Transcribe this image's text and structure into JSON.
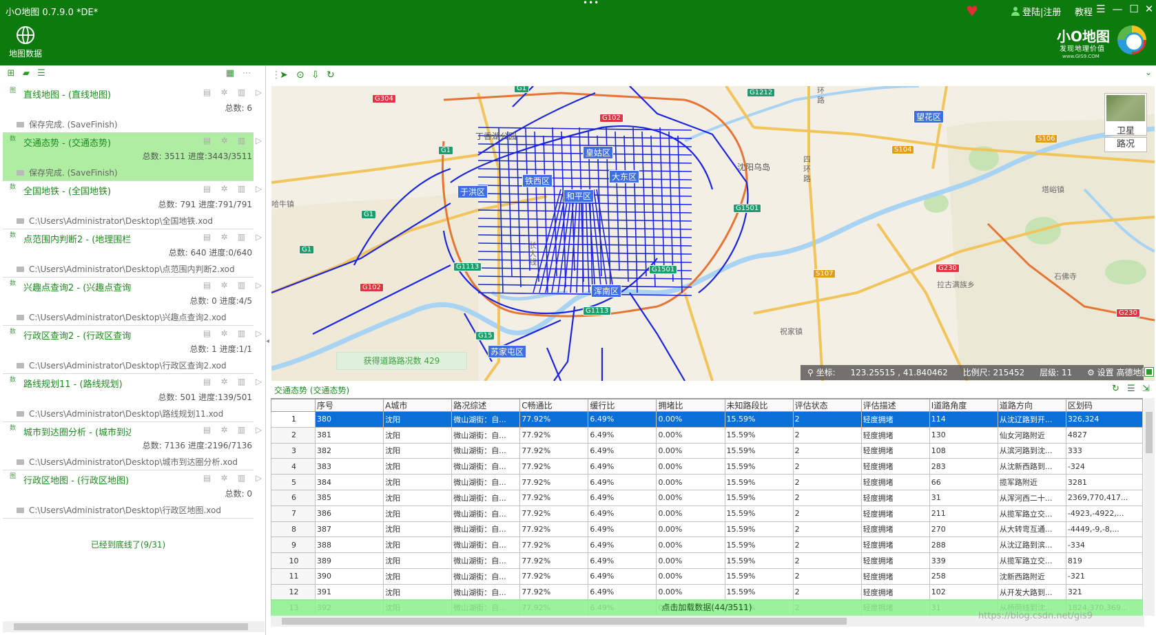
{
  "app": {
    "title": "小O地图 0.7.9.0 *DE*",
    "drag_handle": "•••"
  },
  "header": {
    "login_label": "登陆|注册",
    "tutorial_label": "教程",
    "menu_glyph": "☰",
    "minimize_glyph": "—",
    "maximize_glyph": "☐",
    "close_glyph": "✕",
    "ribbon_map_data_label": "地图数据",
    "brand_name": "小O地图",
    "brand_slogan": "发现地理价值",
    "brand_url": "www.GIS9.COM",
    "colors": {
      "titlebar": "#0d7a0d",
      "heart": "#e52d38"
    }
  },
  "left_panel": {
    "tasks": [
      {
        "kind": "图",
        "name": "直线地图 - (直线地图)",
        "stats": "总数: 6",
        "path": "保存完成. (SaveFinish)",
        "selected": false
      },
      {
        "kind": "数",
        "name": "交通态势 - (交通态势)",
        "stats": "总数: 3511 进度:3443/3511",
        "path": "保存完成. (SaveFinish)",
        "selected": true
      },
      {
        "kind": "数",
        "name": "全国地铁 - (全国地铁)",
        "stats": "总数: 791 进度:791/791",
        "path": "C:\\Users\\Administrator\\Desktop\\全国地铁.xod",
        "selected": false
      },
      {
        "kind": "数",
        "name": "点范围内判断2 - (地理围栏)",
        "stats": "总数: 640 进度:0/640",
        "path": "C:\\Users\\Administrator\\Desktop\\点范围内判断2.xod",
        "selected": false
      },
      {
        "kind": "数",
        "name": "兴趣点查询2 - (兴趣点查询)",
        "stats": "总数: 0 进度:4/5",
        "path": "C:\\Users\\Administrator\\Desktop\\兴趣点查询2.xod",
        "selected": false
      },
      {
        "kind": "数",
        "name": "行政区查询2 - (行政区查询)",
        "stats": "总数: 1 进度:1/1",
        "path": "C:\\Users\\Administrator\\Desktop\\行政区查询2.xod",
        "selected": false
      },
      {
        "kind": "数",
        "name": "路线规划11 - (路线规划)",
        "stats": "总数: 501 进度:139/501",
        "path": "C:\\Users\\Administrator\\Desktop\\路线规划11.xod",
        "selected": false
      },
      {
        "kind": "数",
        "name": "城市到达圈分析 - (城市到达圈",
        "stats": "总数: 7136 进度:2196/7136",
        "path": "C:\\Users\\Administrator\\Desktop\\城市到达圈分析.xod",
        "selected": false
      },
      {
        "kind": "图",
        "name": "行政区地图 - (行政区地图)",
        "stats": "总数: 0",
        "path": "C:\\Users\\Administrator\\Desktop\\行政区地图.xod",
        "selected": false
      }
    ],
    "bottom_message": "已经到底线了(9/31)"
  },
  "map": {
    "districts": [
      "皇姑区",
      "铁西区",
      "于洪区",
      "大东区",
      "和平区",
      "浑南区",
      "苏家屯区"
    ],
    "shields": [
      "G1",
      "G304",
      "G102",
      "G1",
      "G1",
      "G1",
      "G1212",
      "G1501",
      "G1501",
      "G1113",
      "G1113",
      "G102",
      "G15",
      "G230",
      "G230",
      "S104",
      "S106",
      "S107"
    ],
    "place_labels": [
      "丁香湖公园",
      "沈阳乌岛",
      "望花区",
      "哈牛镇",
      "塔峪镇",
      "拉古满族乡",
      "石佛寺",
      "祝家镇",
      "长大线",
      "四环路",
      "环路"
    ],
    "satellite_label": "卫星",
    "traffic_label": "路况",
    "toast": "获得道路路况数 429",
    "status": {
      "coord_label": "坐标:",
      "coord_value": "123.25515 , 41.840462",
      "scale_label": "比例尺:",
      "scale_value": "215452",
      "level_label": "层级:",
      "level_value": "11",
      "settings_label": "设置 高德地图"
    },
    "colors": {
      "roads": "#1a24e0",
      "district_label": "#3d6fe3",
      "shield_national": "#1c9d6c",
      "shield_provincial": "#e29c18"
    }
  },
  "grid": {
    "title": "交通态势 (交通态势)",
    "columns": [
      "序号",
      "A城市",
      "路况综述",
      "C畅通比",
      "缓行比",
      "拥堵比",
      "未知路段比",
      "评估状态",
      "评估描述",
      "I道路角度",
      "道路方向",
      "区划码"
    ],
    "rows": [
      {
        "n": "1",
        "c": [
          "380",
          "沈阳",
          "微山湖街：自...",
          "77.92%",
          "6.49%",
          "0.00%",
          "15.59%",
          "2",
          "轻度拥堵",
          "114",
          "从沈辽路到开...",
          "326,324"
        ]
      },
      {
        "n": "2",
        "c": [
          "381",
          "沈阳",
          "微山湖街：自...",
          "77.92%",
          "6.49%",
          "0.00%",
          "15.59%",
          "2",
          "轻度拥堵",
          "130",
          "仙女河路附近",
          "4827"
        ]
      },
      {
        "n": "3",
        "c": [
          "382",
          "沈阳",
          "微山湖街：自...",
          "77.92%",
          "6.49%",
          "0.00%",
          "15.59%",
          "2",
          "轻度拥堵",
          "108",
          "从滨河路到沈...",
          "333"
        ]
      },
      {
        "n": "4",
        "c": [
          "383",
          "沈阳",
          "微山湖街：自...",
          "77.92%",
          "6.49%",
          "0.00%",
          "15.59%",
          "2",
          "轻度拥堵",
          "283",
          "从沈新西路到...",
          "-324"
        ]
      },
      {
        "n": "5",
        "c": [
          "384",
          "沈阳",
          "微山湖街：自...",
          "77.92%",
          "6.49%",
          "0.00%",
          "15.59%",
          "2",
          "轻度拥堵",
          "66",
          "揽军路附近",
          "3281"
        ]
      },
      {
        "n": "6",
        "c": [
          "385",
          "沈阳",
          "微山湖街：自...",
          "77.92%",
          "6.49%",
          "0.00%",
          "15.59%",
          "2",
          "轻度拥堵",
          "31",
          "从浑河西二十...",
          "2369,770,417..."
        ]
      },
      {
        "n": "7",
        "c": [
          "386",
          "沈阳",
          "微山湖街：自...",
          "77.92%",
          "6.49%",
          "0.00%",
          "15.59%",
          "2",
          "轻度拥堵",
          "211",
          "从揽军路立交...",
          "-4923,-4922,..."
        ]
      },
      {
        "n": "8",
        "c": [
          "387",
          "沈阳",
          "微山湖街：自...",
          "77.92%",
          "6.49%",
          "0.00%",
          "15.59%",
          "2",
          "轻度拥堵",
          "270",
          "从大转弯互通...",
          "-4449,-9,-8,..."
        ]
      },
      {
        "n": "9",
        "c": [
          "388",
          "沈阳",
          "微山湖街：自...",
          "77.92%",
          "6.49%",
          "0.00%",
          "15.59%",
          "2",
          "轻度拥堵",
          "288",
          "从沈辽路到滨...",
          "-334"
        ]
      },
      {
        "n": "10",
        "c": [
          "389",
          "沈阳",
          "微山湖街：自...",
          "77.92%",
          "6.49%",
          "0.00%",
          "15.59%",
          "2",
          "轻度拥堵",
          "339",
          "从揽军路立交...",
          "819"
        ]
      },
      {
        "n": "11",
        "c": [
          "390",
          "沈阳",
          "微山湖街：自...",
          "77.92%",
          "6.49%",
          "0.00%",
          "15.59%",
          "2",
          "轻度拥堵",
          "258",
          "沈新西路附近",
          "-321"
        ]
      },
      {
        "n": "12",
        "c": [
          "391",
          "沈阳",
          "微山湖街：自...",
          "77.92%",
          "6.49%",
          "0.00%",
          "15.59%",
          "2",
          "轻度拥堵",
          "102",
          "从开发大路到...",
          "321"
        ]
      },
      {
        "n": "13",
        "c": [
          "392",
          "沈阳",
          "微山湖街：自...",
          "77.92%",
          "6.49%",
          "0.00%",
          "15.59%",
          "2",
          "轻度拥堵",
          "31",
          "从杨苘线到沈...",
          "1824,370,369..."
        ]
      }
    ],
    "load_more": "点击加载数据(44/3511)",
    "selected_row_color": "#0a6fd6",
    "watermark": "https://blog.csdn.net/gis9"
  }
}
